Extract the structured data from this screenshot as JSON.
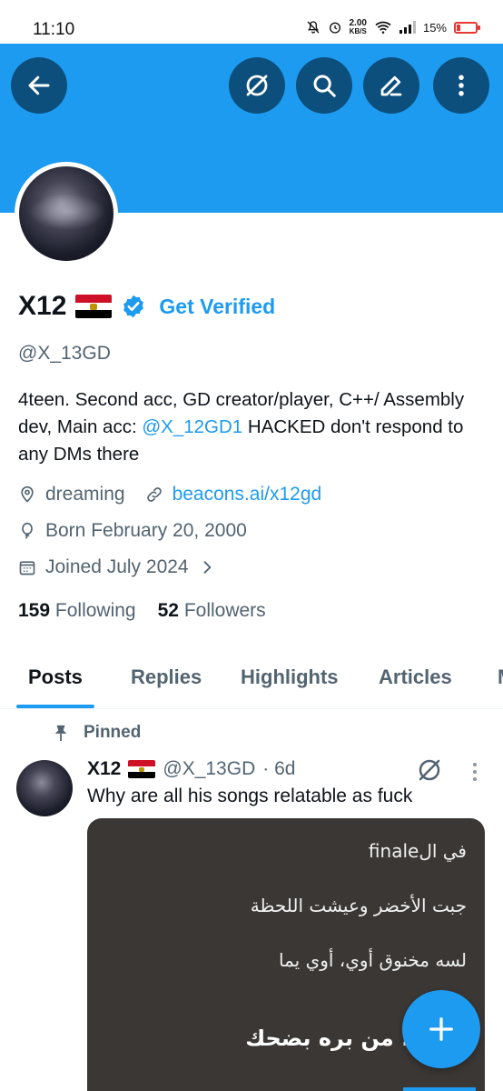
{
  "status_bar": {
    "time": "11:10",
    "net_speed_value": "2.00",
    "net_speed_unit": "KB/S",
    "battery": "15%"
  },
  "header": {
    "back_icon": "arrow-left-icon",
    "grok_icon": "grok-icon",
    "search_icon": "search-icon",
    "edit_icon": "edit-pencil-icon",
    "more_icon": "more-vertical-icon",
    "banner_color": "#1d9bf0"
  },
  "profile": {
    "name": "X12",
    "get_verified": "Get Verified",
    "handle": "@X_13GD",
    "bio_text_1": "4teen. Second acc, GD creator/player, C++/ Assembly dev, Main acc: ",
    "bio_mention": "@X_12GD1",
    "bio_text_2": " HACKED don't respond to any DMs there",
    "location": "dreaming",
    "website": "beacons.ai/x12gd",
    "birthday": "Born February 20, 2000",
    "joined": "Joined July 2024",
    "following_count": "159",
    "following_label": "Following",
    "followers_count": "52",
    "followers_label": "Followers"
  },
  "tabs": [
    {
      "label": "Posts",
      "active": true
    },
    {
      "label": "Replies",
      "active": false
    },
    {
      "label": "Highlights",
      "active": false
    },
    {
      "label": "Articles",
      "active": false
    },
    {
      "label": "M",
      "active": false
    }
  ],
  "pinned_post": {
    "pinned_label": "Pinned",
    "author_name": "X12",
    "author_handle": "@X_13GD",
    "time": "· 6d",
    "text": "Why are all his songs relatable as fuck",
    "media_lines": [
      "في الfinale",
      "جبت الأخضر وعيشت اللحظة",
      "لسه مخنوق أوي، أوي يما",
      "صراع، من بره بضحك"
    ]
  },
  "fab": {
    "icon": "plus-icon"
  }
}
